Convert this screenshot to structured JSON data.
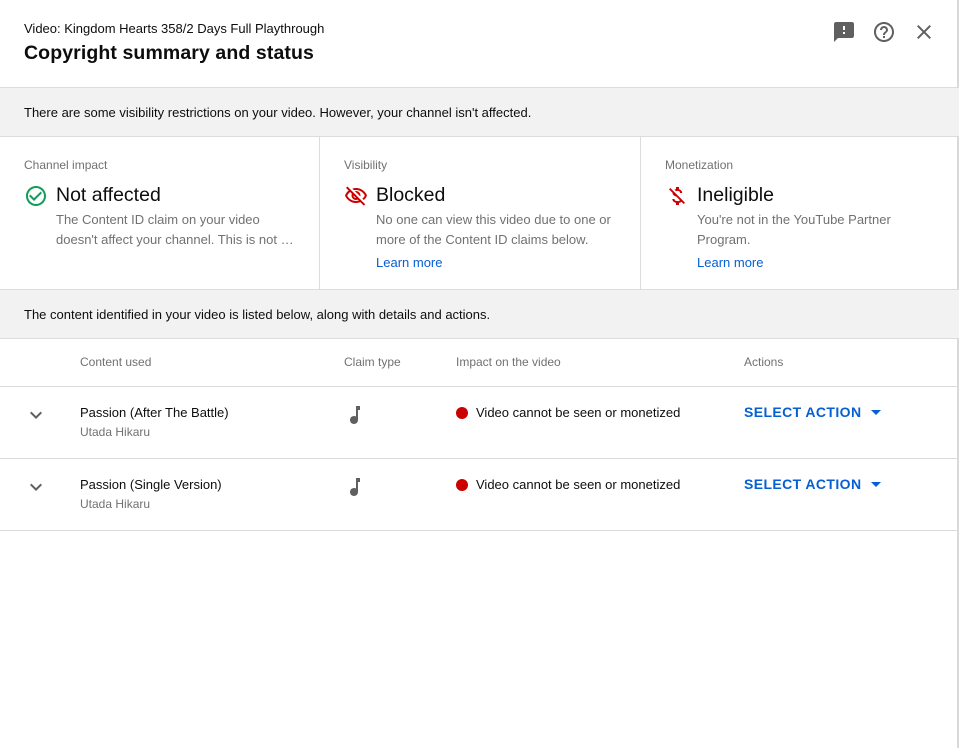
{
  "header": {
    "video_title": "Video: Kingdom Hearts 358/2 Days Full Playthrough",
    "dialog_title": "Copyright summary and status",
    "icons": [
      "feedback-icon",
      "help-icon",
      "close-icon"
    ]
  },
  "banner_top": "There are some visibility restrictions on your video. However, your channel isn't affected.",
  "status_cards": [
    {
      "label": "Channel impact",
      "value": "Not affected",
      "description": "The Content ID claim on your video doesn't affect your channel. This is not …",
      "icon": "check-circle-icon",
      "color": "#0f9d58"
    },
    {
      "label": "Visibility",
      "value": "Blocked",
      "description": "No one can view this video due to one or more of the Content ID claims below.",
      "link": "Learn more",
      "icon": "visibility-off-icon",
      "color": "#cc0000"
    },
    {
      "label": "Monetization",
      "value": "Ineligible",
      "description": "You're not in the YouTube Partner Program.",
      "link": "Learn more",
      "icon": "money-off-icon",
      "color": "#cc0000"
    }
  ],
  "banner_mid": "The content identified in your video is listed below, along with details and actions.",
  "table": {
    "headers": [
      "Content used",
      "Claim type",
      "Impact on the video",
      "Actions"
    ],
    "rows": [
      {
        "title": "Passion (After The Battle)",
        "artist": "Utada Hikaru",
        "claim_type_icon": "music-note-icon",
        "impact": "Video cannot be seen or monetized",
        "impact_color": "#cc0000",
        "action": "SELECT ACTION"
      },
      {
        "title": "Passion (Single Version)",
        "artist": "Utada Hikaru",
        "claim_type_icon": "music-note-icon",
        "impact": "Video cannot be seen or monetized",
        "impact_color": "#cc0000",
        "action": "SELECT ACTION"
      }
    ]
  },
  "colors": {
    "accent": "#065fd4",
    "error": "#cc0000",
    "success": "#0f9d58",
    "secondary_text": "#717171"
  }
}
